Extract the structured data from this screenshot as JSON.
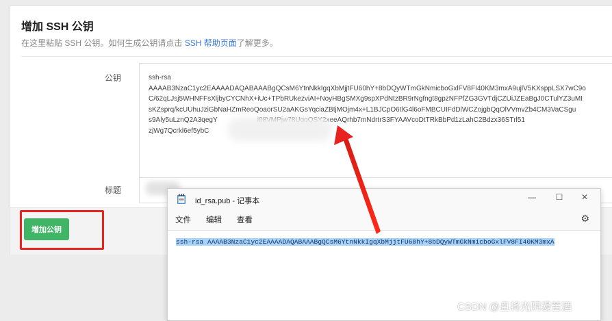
{
  "page": {
    "title": "增加 SSH 公钥",
    "subtitle_text": "在这里粘贴 SSH 公钥。如何生成公钥请点击 SSH 帮助页面了解更多。",
    "subtitle_prefix": "在这里粘贴 SSH 公钥。如何生成公钥请点击 ",
    "subtitle_link": "SSH 帮助页面",
    "subtitle_suffix": "了解更多。"
  },
  "form": {
    "key_label": "公钥",
    "key_value": "ssh-rsa\nAAAAB3NzaC1yc2EAAAADAQABAAABgQCsM6YtnNkkIgqXbMjjtFU60hY+8bDQyWTmGkNmicboGxlFV8FI40KM3mxA9ujlV5KXsppLSX7wC9o\nC/62qLJsj5WHNFFsXljbyCYCNhX+iUc+TPbRUkezviAI+NoyHBgSMXg9spXPdNtzBR9rNgfngt8gpzNFPfZG3GVTdjCZUiJZEaBgJ0CTulYZ3uMI\nsKZsprq/kcUUhuJziGbNaHZmReoQoaorSU2aAKGsYqciaZBtjMOjm4x+L1BJCpO6tlG4l6oFMBCUIFdDlWCZojgbQqOlVVmvZb4CM3VaCSgu\ns9Aly5uLznQ2A3qegY                     i08VMPjw78UqqQSY2xeeAQrhb7mNdrtrS3FYAAVcoDtTRkBbPd1zLahC2Bdzx36STrl51\nzjWg7Qcrkl6ef5ybC",
    "title_label": "标题",
    "submit_label": "增加公钥"
  },
  "notepad": {
    "window_title": "id_rsa.pub - 记事本",
    "menu": [
      "文件",
      "编辑",
      "查看"
    ],
    "content": "ssh-rsa AAAAB3NzaC1yc2EAAAADAQABAAABgQCsM6YtnNkkIgqXbMjjtFU60hY+8bDQyWTmGkNmicboGxlFV8FI40KM3mxA",
    "minimize_glyph": "—",
    "maximize_glyph": "☐",
    "close_glyph": "✕",
    "gear_glyph": "⚙"
  },
  "watermark": "CSDN @且将光阴漫苦酒",
  "colors": {
    "submit_green": "#3fb565",
    "annotation_red": "#e8231f",
    "link_blue": "#3b7dd8",
    "selection_blue": "#a8d4f8"
  },
  "icons": [
    "notepad-icon",
    "gear-icon",
    "minimize-icon",
    "maximize-icon",
    "close-icon",
    "arrow-annotation"
  ]
}
